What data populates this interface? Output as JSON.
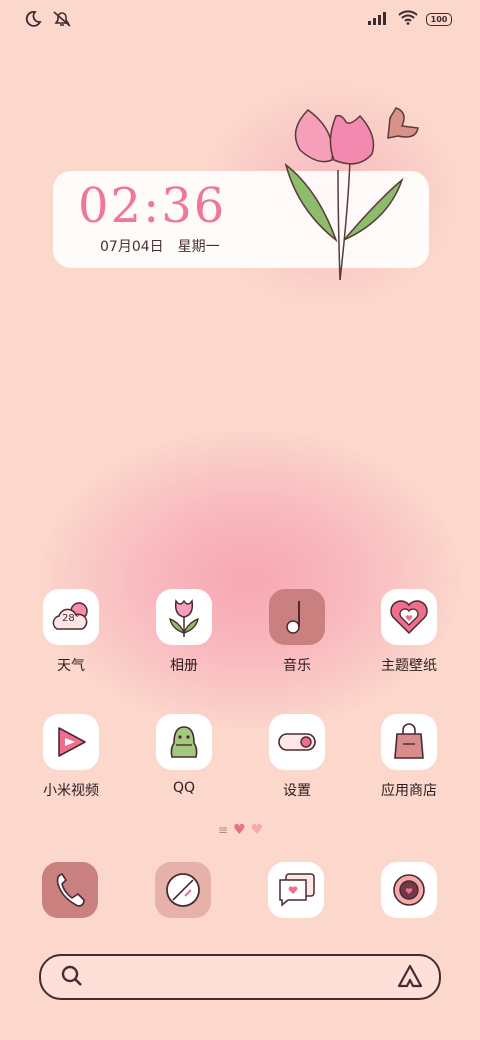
{
  "status_bar": {
    "battery": "100",
    "icons": [
      "moon-icon",
      "mute-bell-icon",
      "signal-icon",
      "wifi-icon",
      "battery-icon"
    ]
  },
  "clock": {
    "time": "02:36",
    "date": "07月04日",
    "weekday": "星期一"
  },
  "apps": [
    {
      "label": "天气",
      "icon": "weather-icon",
      "badge": "28°"
    },
    {
      "label": "相册",
      "icon": "gallery-icon"
    },
    {
      "label": "音乐",
      "icon": "music-icon"
    },
    {
      "label": "主题壁纸",
      "icon": "themes-icon"
    },
    {
      "label": "小米视频",
      "icon": "video-icon"
    },
    {
      "label": "QQ",
      "icon": "qq-icon"
    },
    {
      "label": "设置",
      "icon": "settings-icon"
    },
    {
      "label": "应用商店",
      "icon": "app-store-icon"
    }
  ],
  "dock": [
    "phone-icon",
    "browser-icon",
    "messages-icon",
    "camera-icon"
  ],
  "search": {
    "left_icon": "search-icon",
    "right_icon": "assistant-icon"
  },
  "colors": {
    "background": "#fbd7cc",
    "accent": "#ee7896",
    "dark": "#4a2a32"
  }
}
